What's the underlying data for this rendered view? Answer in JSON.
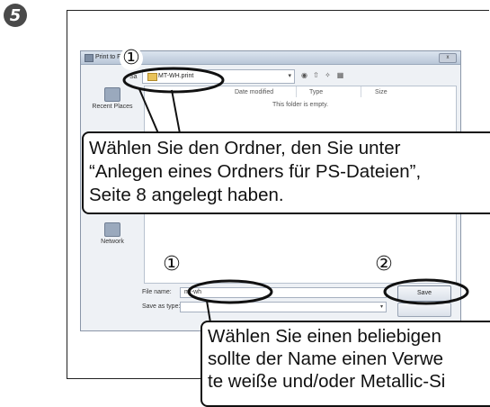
{
  "step_number": "5",
  "dialog": {
    "title": "Print to File",
    "save_in_label": "Sa",
    "path": "MT-WH.print",
    "close_symbol": "x",
    "places": [
      "Recent Places",
      "Network"
    ],
    "columns": [
      "Date modified",
      "Type",
      "Size"
    ],
    "empty_message": "This folder is empty.",
    "file_name_label": "File name:",
    "file_name_value": "mt-wh",
    "save_as_type_label": "Save as type:",
    "save_button": "Save"
  },
  "markers": {
    "path_marker": "①",
    "filename_marker": "①",
    "save_marker": "②"
  },
  "callouts": {
    "folder_text": [
      "Wählen Sie den Ordner, den Sie unter",
      "“Anlegen eines Ordners für PS-Dateien”,",
      "Seite 8 angelegt haben."
    ],
    "filename_text": [
      "Wählen Sie einen beliebigen",
      "sollte der Name einen Verwe",
      "te weiße und/oder Metallic-Si"
    ]
  }
}
